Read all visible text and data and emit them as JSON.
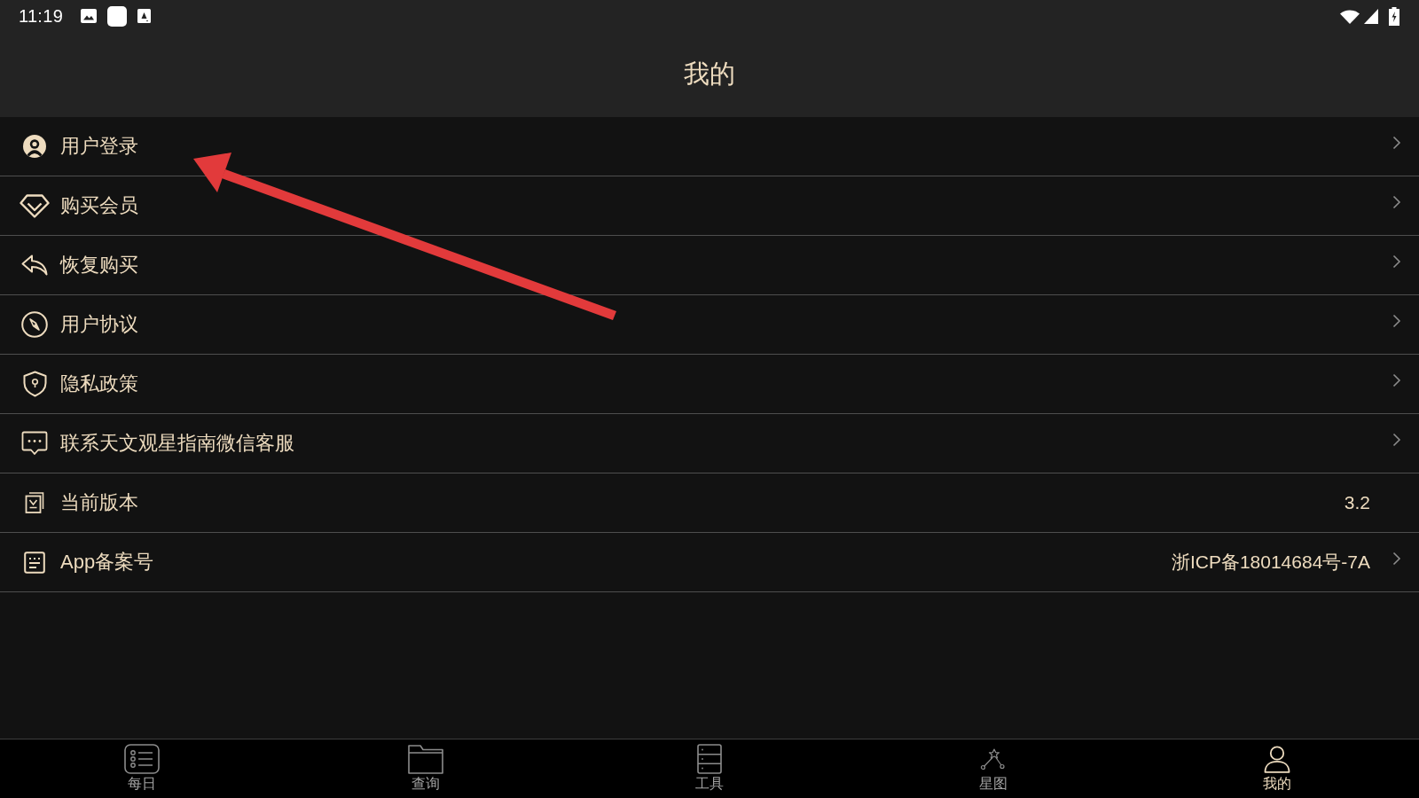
{
  "status_bar": {
    "time": "11:19"
  },
  "header": {
    "title": "我的"
  },
  "menu": [
    {
      "label": "用户登录",
      "chevron": true
    },
    {
      "label": "购买会员",
      "chevron": true
    },
    {
      "label": "恢复购买",
      "chevron": true
    },
    {
      "label": "用户协议",
      "chevron": true
    },
    {
      "label": "隐私政策",
      "chevron": true
    },
    {
      "label": "联系天文观星指南微信客服",
      "chevron": true
    },
    {
      "label": "当前版本",
      "value": "3.2",
      "chevron": false
    },
    {
      "label": "App备案号",
      "value": "浙ICP备18014684号-7A",
      "chevron": true
    }
  ],
  "bottom_nav": [
    {
      "label": "每日",
      "selected": false
    },
    {
      "label": "查询",
      "selected": false
    },
    {
      "label": "工具",
      "selected": false
    },
    {
      "label": "星图",
      "selected": false
    },
    {
      "label": "我的",
      "selected": true
    }
  ]
}
